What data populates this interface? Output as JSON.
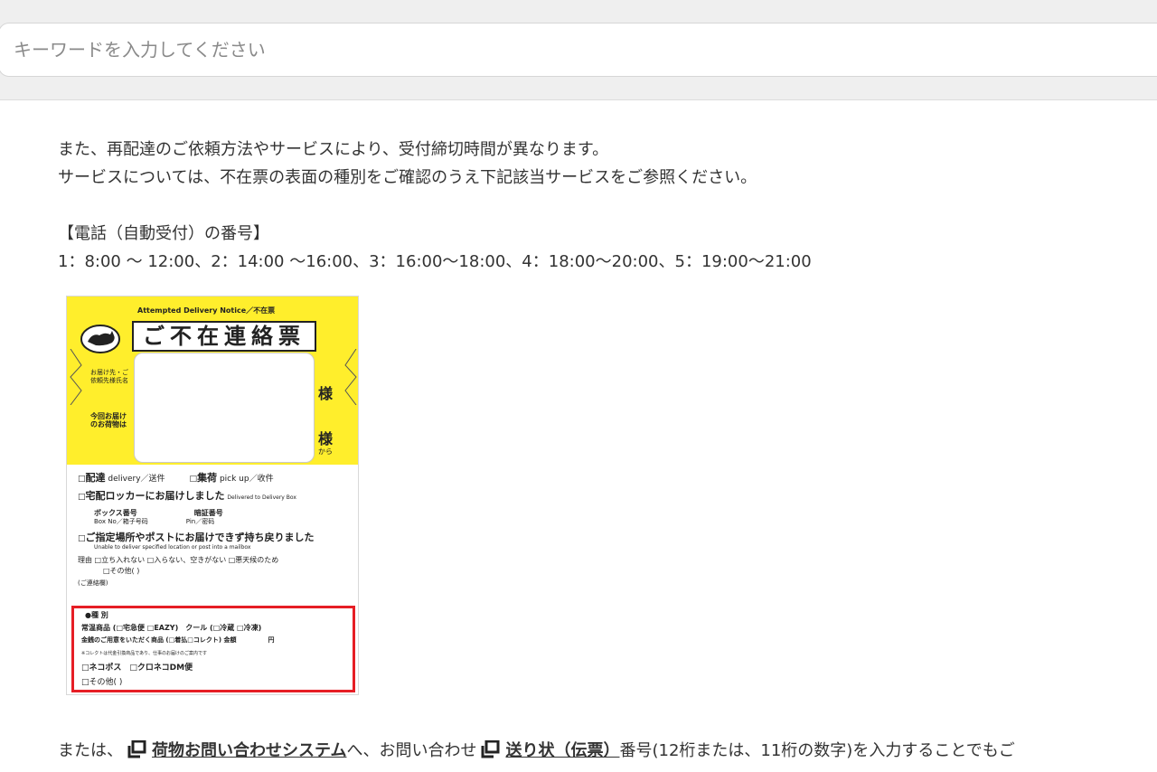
{
  "search": {
    "placeholder": "キーワードを入力してください"
  },
  "content": {
    "lines": [
      "また、再配達のご依頼方法やサービスにより、受付締切時間が異なります。",
      "サービスについては、不在票の表面の種別をご確認のうえ下記該当サービスをご参照ください。"
    ],
    "phone_heading": "【電話（自動受付）の番号】",
    "phone_times": "1：8:00 ～ 12:00、2：14:00 ～16:00、3：16:00～18:00、4：18:00～20:00、5：19:00～21:00"
  },
  "notice": {
    "top_label": "Attempted Delivery Notice／不在票",
    "title": "ご不在連絡票",
    "addressee_label": "お届け先・ご依頼先様氏名",
    "today_label": "今回お届けのお荷物は",
    "sama": "様",
    "kara": "から",
    "haitatsu": "配達",
    "delivery_en": "delivery／送件",
    "shuka": "集荷",
    "pickup_en": "pick up／收件",
    "locker": "宅配ロッカーにお届けしました",
    "locker_en": "Delivered to Delivery Box",
    "box_no": "ボックス番号",
    "box_no_en": "Box No／箱子号码",
    "pin": "暗証番号",
    "pin_en": "Pin／密码",
    "return": "ご指定場所やポストにお届けできず持ち戻りました",
    "return_en": "Unable to deliver specified location or post into a mailbox",
    "reason": "理由 □立ち入れない □入らない、空きがない □悪天候のため",
    "other": "□その他(                                    )",
    "note": "(ご連絡欄)",
    "kind": "●種 別",
    "normal": "常温商品 (□宅急便 □EAZY)　クール (□冷蔵 □冷凍)",
    "payment": "金銭のご用意をいただく商品 (□着払□コレクト) 金額　　　　　円",
    "small_note": "※コレクトは代金引換商品であり、仕事のお届けのご案内です",
    "nekopos": "□ネコポス　□クロネコDM便",
    "red_other": "□その他(                                          )"
  },
  "bottom": {
    "prefix": "または、",
    "link1": "荷物お問い合わせシステム",
    "middle": "へ、お問い合わせ",
    "link2": "送り状（伝票）",
    "suffix": "番号(12桁または、11桁の数字)を入力することでもご"
  }
}
